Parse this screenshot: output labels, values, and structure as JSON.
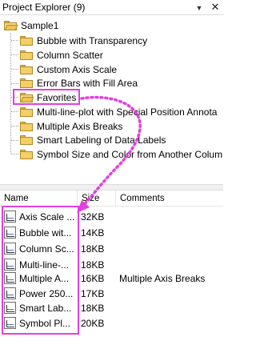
{
  "titlebar": {
    "title": "Project Explorer (9)",
    "pin_icon": "pin-icon",
    "close_icon": "close-icon"
  },
  "tree": {
    "root": {
      "label": "Sample1",
      "icon": "folder-icon"
    },
    "items": [
      {
        "label": "Bubble with Transparency",
        "icon": "folder-icon"
      },
      {
        "label": "Column Scatter",
        "icon": "folder-icon"
      },
      {
        "label": "Custom Axis Scale",
        "icon": "folder-icon"
      },
      {
        "label": "Error Bars with Fill Area",
        "icon": "folder-icon"
      },
      {
        "label": "Favorites",
        "icon": "open-folder-icon",
        "selected": true
      },
      {
        "label": "Multi-line-plot with Special Position Annota",
        "icon": "folder-icon"
      },
      {
        "label": "Multiple Axis Breaks",
        "icon": "folder-icon"
      },
      {
        "label": "Smart Labeling of Data Labels",
        "icon": "folder-icon"
      },
      {
        "label": "Symbol Size and Color from Another Colum",
        "icon": "folder-icon"
      }
    ]
  },
  "list": {
    "columns": [
      "Name",
      "Size",
      "Comments"
    ],
    "rows": [
      {
        "name": "Axis Scale ...",
        "size": "32KB",
        "comment": "",
        "icon": "graph-icon"
      },
      {
        "name": "Bubble wit...",
        "size": "14KB",
        "comment": "",
        "icon": "graph-icon"
      },
      {
        "name": "Column Sc...",
        "size": "18KB",
        "comment": "",
        "icon": "graph-icon"
      },
      {
        "name": "Multi-line-...",
        "size": "18KB",
        "comment": "",
        "icon": "graph-icon"
      },
      {
        "name": "Multiple A...",
        "size": "16KB",
        "comment": "Multiple Axis Breaks",
        "icon": "graph-icon"
      },
      {
        "name": "Power 250...",
        "size": "17KB",
        "comment": "",
        "icon": "graph-icon"
      },
      {
        "name": "Smart Lab...",
        "size": "18KB",
        "comment": "",
        "icon": "graph-icon"
      },
      {
        "name": "Symbol Pl...",
        "size": "20KB",
        "comment": "",
        "icon": "graph-icon"
      }
    ]
  },
  "colors": {
    "highlight": "#e040e0",
    "folder": "#f3cf66"
  }
}
